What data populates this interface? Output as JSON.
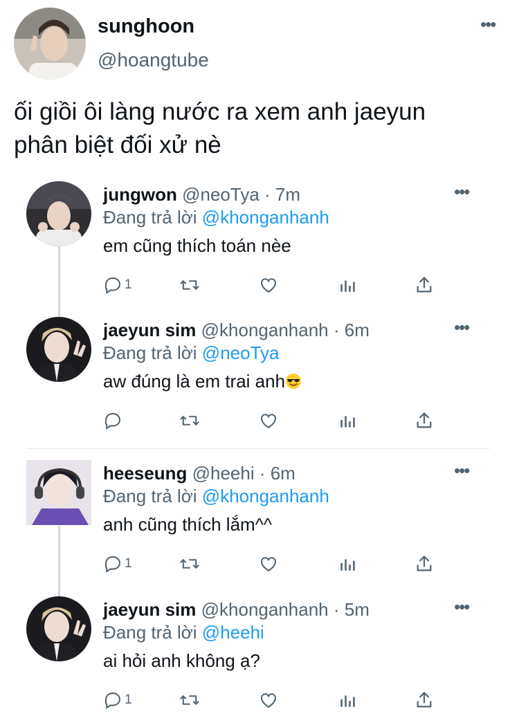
{
  "tweet": {
    "author_name": "sunghoon",
    "author_handle": "@hoangtube",
    "more_icon": "more-dots-icon",
    "text_line1": "ối giồi ôi làng nước ra xem anh jaeyun",
    "text_line2": "phân biệt đối xử nè"
  },
  "replies": [
    {
      "name": "jungwon",
      "handle": "@neoTya · 7m",
      "replying_prefix": "Đang trả lời",
      "replying_to": "@khonganhanh",
      "text": "em cũng thích toán nèe",
      "reply_count": "1"
    },
    {
      "name": "jaeyun sim",
      "handle": "@khonganhanh · 6m",
      "replying_prefix": "Đang trả lời",
      "replying_to": "@neoTya",
      "text": "aw đúng là em trai anh",
      "emoji": "sunglasses-emoji",
      "reply_count": ""
    },
    {
      "name": "heeseung",
      "handle": "@heehi · 6m",
      "replying_prefix": "Đang trả lời",
      "replying_to": "@khonganhanh",
      "text": "anh cũng thích lắm^^",
      "reply_count": "1"
    },
    {
      "name": "jaeyun sim",
      "handle": "@khonganhanh · 5m",
      "replying_prefix": "Đang trả lời",
      "replying_to": "@heehi",
      "text": "ai hỏi anh không ạ?",
      "reply_count": "1"
    }
  ],
  "colors": {
    "link": "#1d9bf0",
    "secondary_text": "#536471",
    "thread_line": "#cfd9de"
  }
}
